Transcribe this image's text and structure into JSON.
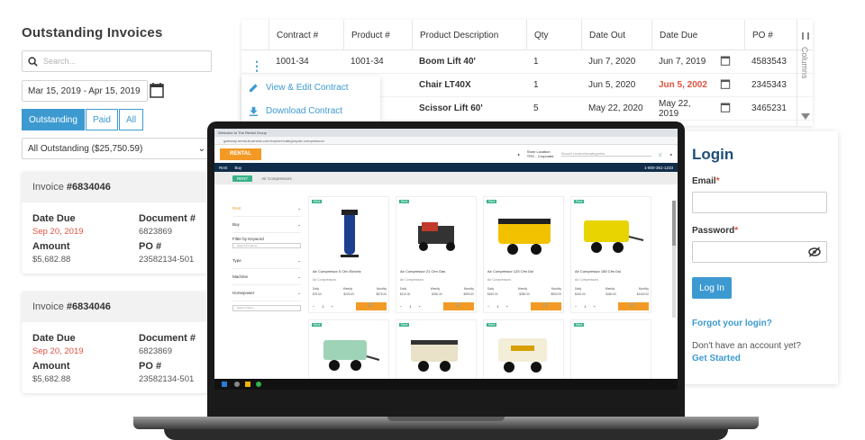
{
  "invoices": {
    "title": "Outstanding Invoices",
    "search_placeholder": "Search...",
    "date_range": "Mar 15, 2019 - Apr 15, 2019",
    "tabs": [
      "Outstanding",
      "Paid",
      "All"
    ],
    "filter_select": "All Outstanding ($25,750.59)",
    "cards": [
      {
        "prefix": "Invoice ",
        "number": "#6834046",
        "date_due_label": "Date Due",
        "date_due": "Sep 20, 2019",
        "document_label": "Document #",
        "document": "6823869",
        "amount_label": "Amount",
        "amount": "$5,682.88",
        "po_label": "PO #",
        "po": "23582134-501"
      },
      {
        "prefix": "Invoice ",
        "number": "#6834046",
        "date_due_label": "Date Due",
        "date_due": "Sep 20, 2019",
        "document_label": "Document #",
        "document": "6823869",
        "amount_label": "Amount",
        "amount": "$5,682.88",
        "po_label": "PO #",
        "po": "23582134-501"
      }
    ]
  },
  "table": {
    "headers": [
      "Contract #",
      "Product #",
      "Product Description",
      "Qty",
      "Date Out",
      "Date Due",
      "PO #"
    ],
    "rows": [
      {
        "contract": "1001-34",
        "product": "1001-34",
        "desc": "Boom Lift 40'",
        "qty": "1",
        "out": "Jun 7, 2020",
        "due": "Jun 7, 2019",
        "po": "4583543"
      },
      {
        "contract": "",
        "product": "",
        "desc": "Chair LT40X",
        "qty": "1",
        "out": "Jun 5, 2020",
        "due": "Jun 5, 2002",
        "po": "2345343"
      },
      {
        "contract": "",
        "product": "",
        "desc": "Scissor Lift 60'",
        "qty": "5",
        "out": "May 22, 2020",
        "due": "May 22, 2019",
        "po": "3465231"
      }
    ],
    "side_label": "Columns",
    "menu": [
      "View & Edit Contract",
      "Download Contract"
    ]
  },
  "login": {
    "title": "Login",
    "email_label": "Email",
    "password_label": "Password",
    "required_mark": "*",
    "button": "Log In",
    "forgot": "Forgot your login?",
    "no_account": "Don't have an account yet?",
    "get_started": "Get Started"
  },
  "site": {
    "tab_title": "Welcome to The Rental Group",
    "url": "gateway.rental-business.com/explore/category/air-compressors",
    "logo": "RENTAL",
    "store_label": "Store Location",
    "store_value": "TRG - Corporate",
    "search_placeholder": "Search products/categories",
    "nav": [
      "Rent",
      "Buy"
    ],
    "phone": "1-800-361-1233",
    "crumb_pill": "RENT",
    "crumb": "Air Compressors",
    "filters": [
      "Rent",
      "Buy",
      "Filter by Keyword",
      "Type",
      "Machine",
      "Horsepower"
    ],
    "keyword_placeholder": "Search Products",
    "hp_placeholder": "Search Filters",
    "products": [
      {
        "tag": "Rent",
        "name": "Air Compressor 5 Cfm Electric",
        "cat": "Air Compressors",
        "daily": "$75.00",
        "weekly": "$225.00",
        "monthly": "$675.00"
      },
      {
        "tag": "Rent",
        "name": "Air Compressor 21 Cfm Gas",
        "cat": "Air Compressors",
        "daily": "$110.00",
        "weekly": "$330.00",
        "monthly": "$990.00"
      },
      {
        "tag": "Rent",
        "name": "Air Compressor 125 Cfm Dsl",
        "cat": "Air Compressors",
        "daily": "$160.00",
        "weekly": "$380.00",
        "monthly": "$900.00"
      },
      {
        "tag": "Rent",
        "name": "Air Compressor 185 Cfm Dsl",
        "cat": "Air Compressors",
        "daily": "$160.00",
        "weekly": "$480.00",
        "monthly": "$1440.00"
      }
    ],
    "price_labels": [
      "Daily",
      "Weekly",
      "Monthly"
    ],
    "qty": "1"
  },
  "colors": {
    "accent": "#3d9ad1",
    "danger": "#e0523e",
    "brand_orange": "#f29a25",
    "navy": "#0f2d4a"
  }
}
